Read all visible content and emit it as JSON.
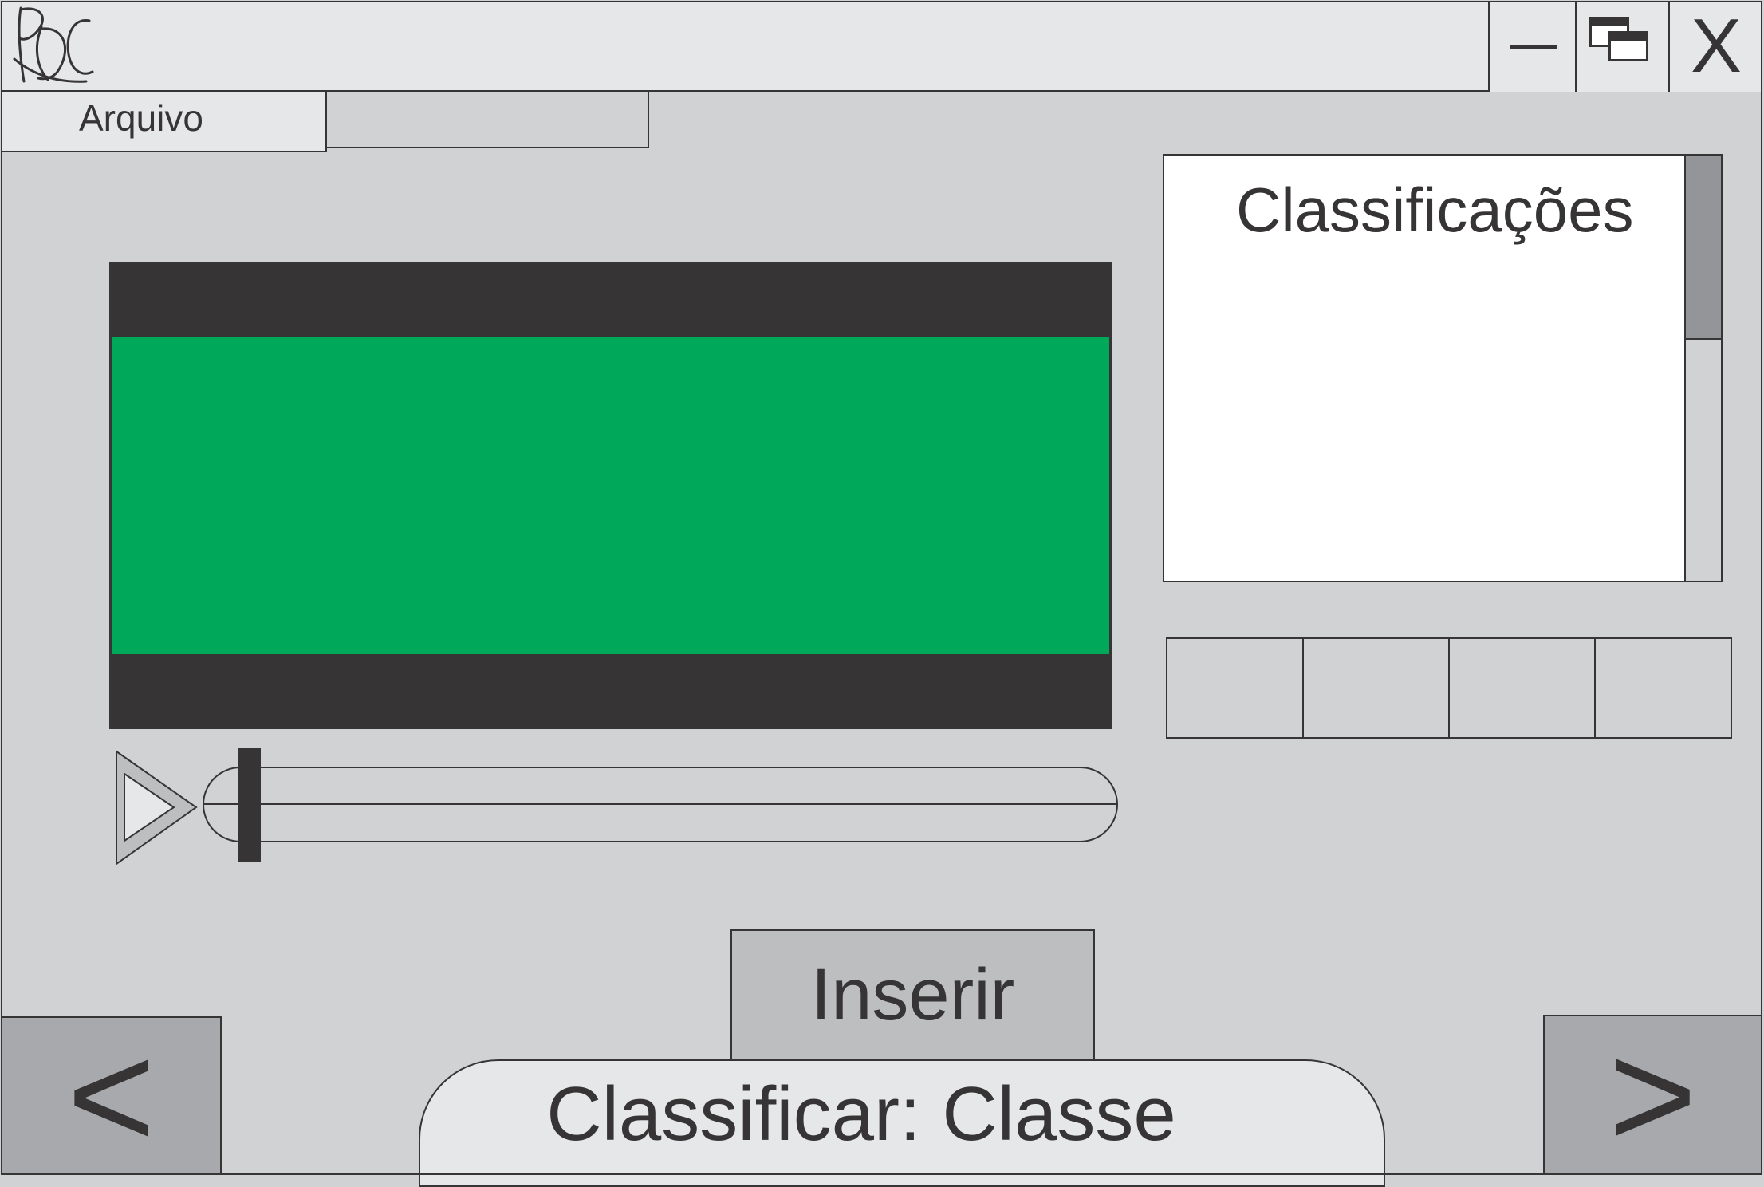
{
  "titlebar": {
    "logo": "pdc-script-logo",
    "controls": {
      "minimize": "minimize-icon",
      "restore": "restore-windows-icon",
      "close_label": "X"
    }
  },
  "menubar": {
    "items": [
      {
        "label": "Arquivo"
      },
      {
        "label": ""
      }
    ]
  },
  "video": {
    "content_color": "#00a859",
    "frame_color": "#363435"
  },
  "player": {
    "play_icon": "play-icon",
    "progress": 0.03
  },
  "classifications_panel": {
    "title": "Classificações",
    "items": []
  },
  "class_boxes": [
    "",
    "",
    "",
    ""
  ],
  "actions": {
    "insert_label": "Inserir",
    "classify_label": "Classificar: Classe",
    "prev_label": "<",
    "next_label": ">"
  },
  "colors": {
    "background": "#d1d2d4",
    "light_panel": "#e6e7e8",
    "button": "#bcbec0",
    "nav_button": "#a7a9ac",
    "scroll_thumb": "#939598",
    "ink": "#363435"
  }
}
